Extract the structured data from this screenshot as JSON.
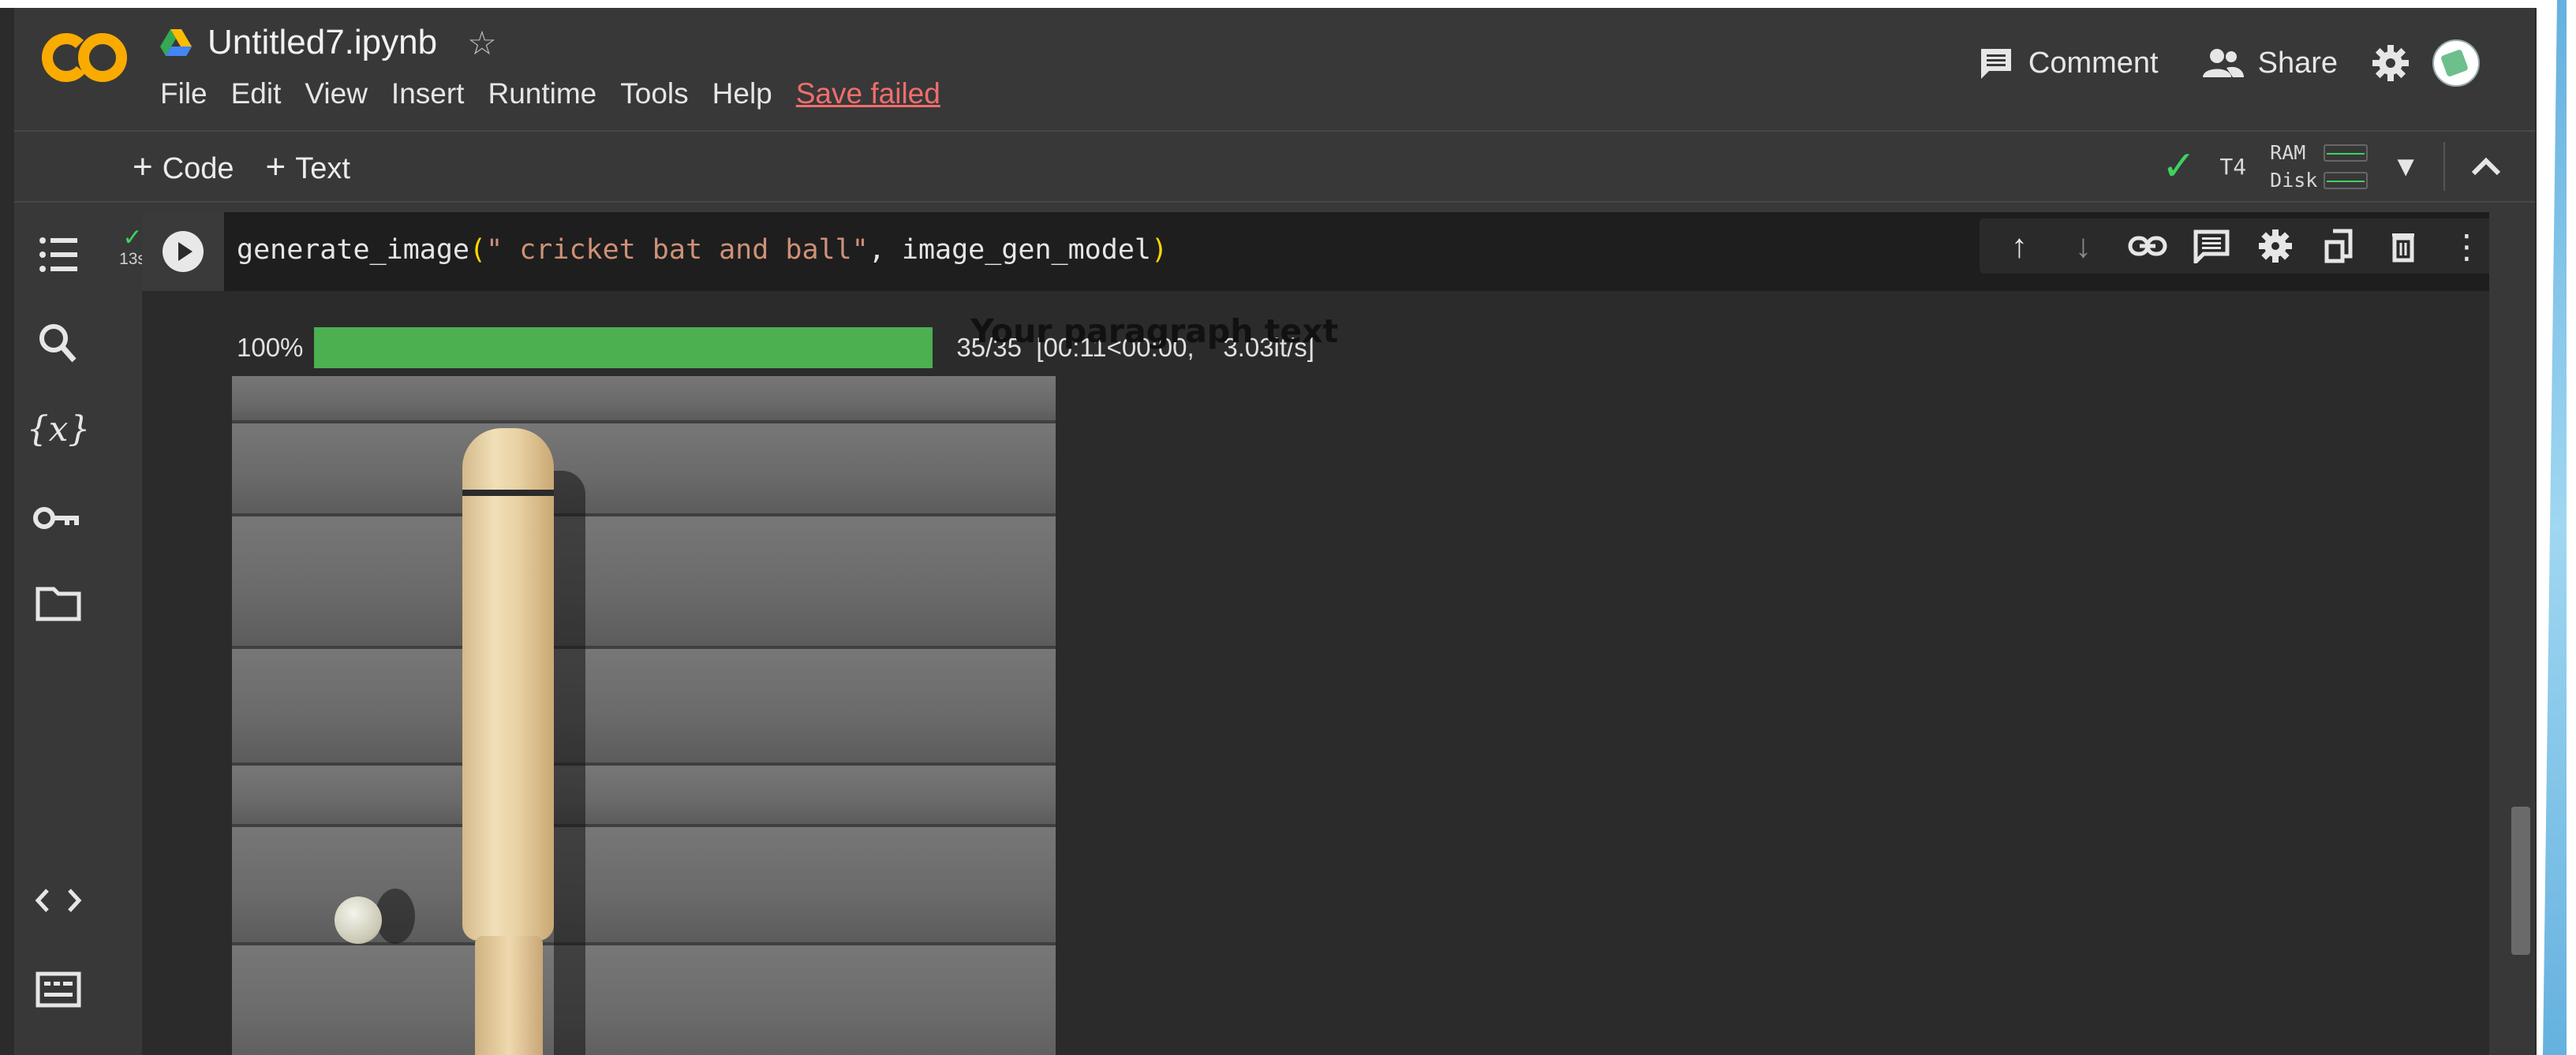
{
  "header": {
    "logo_text": "CO",
    "title": "Untitled7.ipynb",
    "menu": [
      "File",
      "Edit",
      "View",
      "Insert",
      "Runtime",
      "Tools",
      "Help"
    ],
    "save_status": "Save failed",
    "comment_label": "Comment",
    "share_label": "Share"
  },
  "toolbar": {
    "add_code": "Code",
    "add_text": "Text",
    "runtime": "T4",
    "ram_label": "RAM",
    "disk_label": "Disk"
  },
  "cell": {
    "exec_time": "13s",
    "code_fn": "generate_image",
    "code_arg1": "\" cricket bat and ball\"",
    "code_rest": ", image_gen_model",
    "progress_percent_label": "100%",
    "progress_fraction": 1.0,
    "progress_stats": "35/35  [00:11<00:00,    3.03it/s]",
    "paragraph_text": "Your paragraph text"
  },
  "colors": {
    "accent_green": "#4caf50",
    "error_red": "#f16d6d",
    "logo_orange": "#f9ab00"
  }
}
